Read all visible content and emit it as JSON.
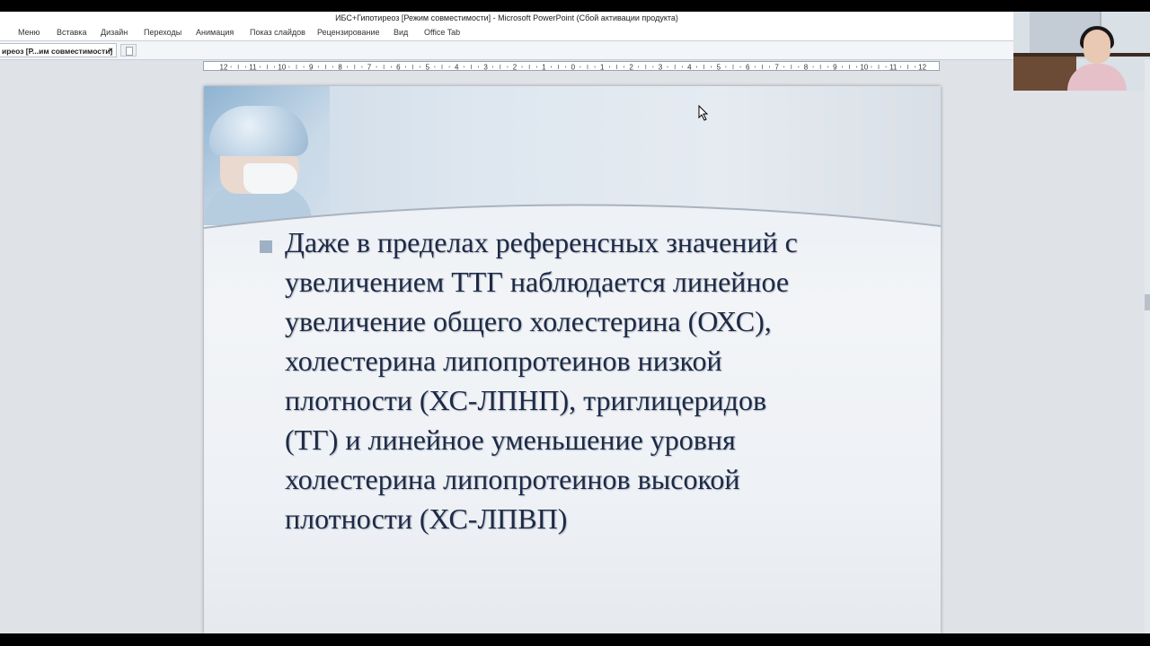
{
  "window": {
    "title": "ИБС+Гипотиреоз [Режим совместимости]  -  Microsoft PowerPoint (Сбой активации продукта)"
  },
  "ribbon": {
    "tabs": [
      "Меню",
      "Вставка",
      "Дизайн",
      "Переходы",
      "Анимация",
      "Показ слайдов",
      "Рецензирование",
      "Вид",
      "Office Tab"
    ]
  },
  "doc_tabs": {
    "active_label": "иреоз [Р...им совместимости]",
    "close": "×"
  },
  "ruler": {
    "labels": [
      "12",
      "11",
      "10",
      "9",
      "8",
      "7",
      "6",
      "5",
      "4",
      "3",
      "2",
      "1",
      "0",
      "1",
      "2",
      "3",
      "4",
      "5",
      "6",
      "7",
      "8",
      "9",
      "10",
      "11",
      "12"
    ]
  },
  "slide": {
    "bullet_lines": [
      "Даже в пределах референсных значений с",
      "увеличением ТТГ наблюдается линейное",
      "увеличение общего холестерина (ОХС),",
      "холестерина липопротеинов низкой",
      "плотности (ХС-ЛПНП), триглицеридов",
      "(ТГ) и линейное уменьшение уровня",
      "холестерина липопротеинов высокой",
      "плотности (ХС-ЛПВП)"
    ]
  }
}
